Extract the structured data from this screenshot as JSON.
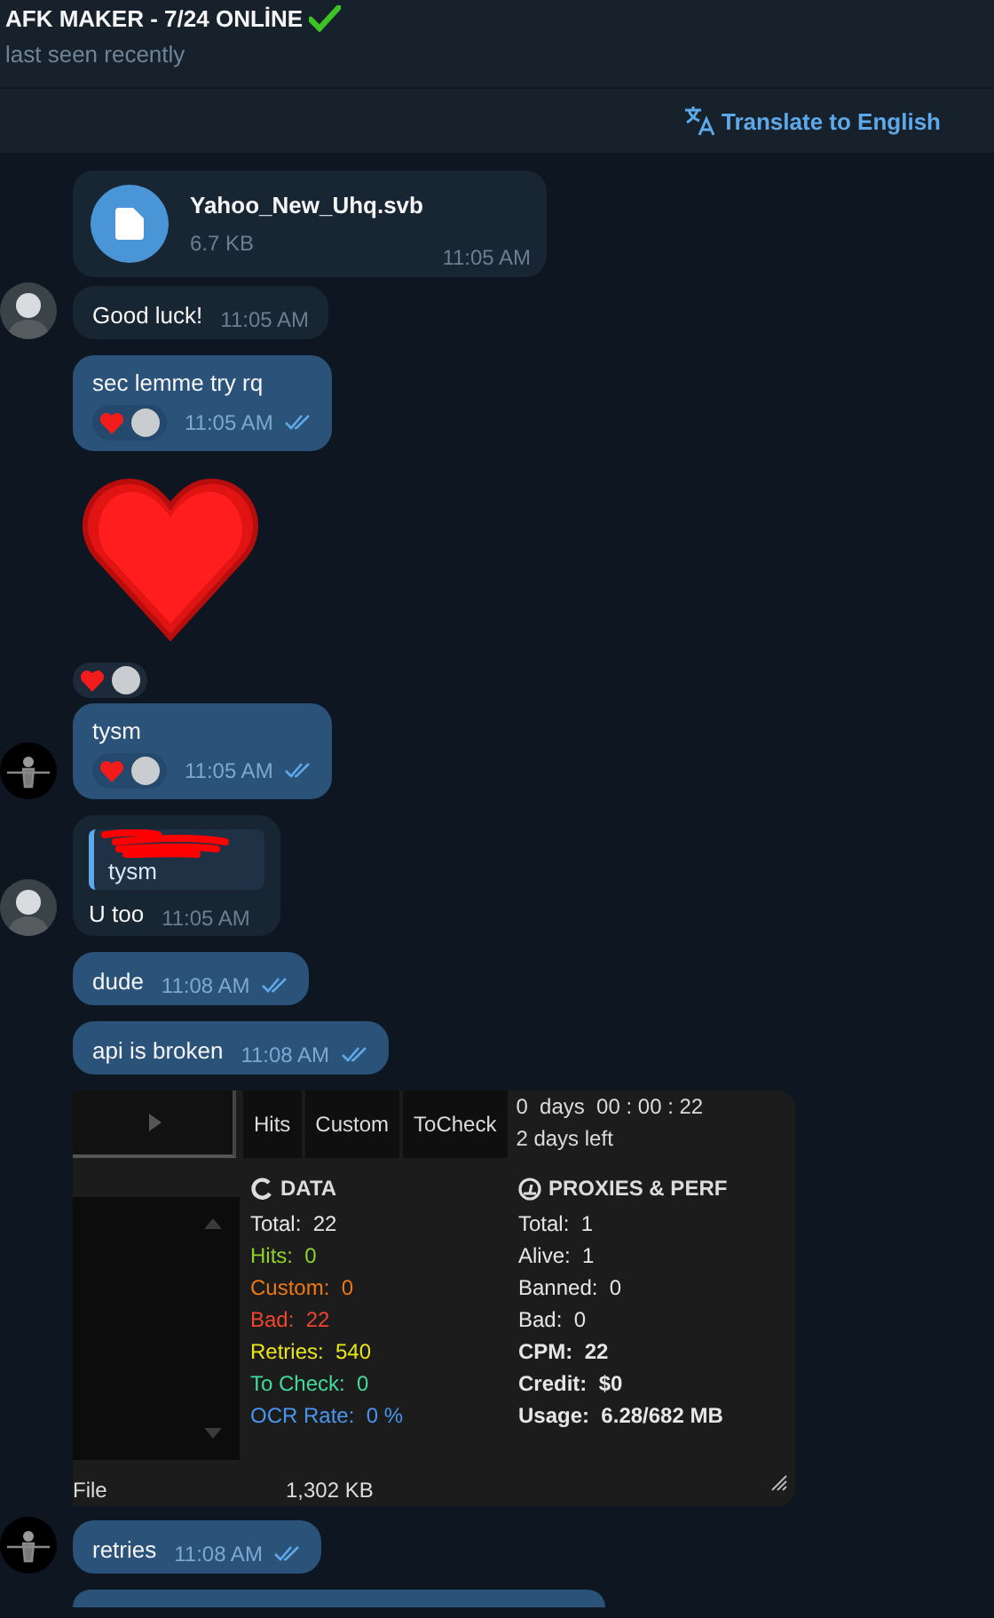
{
  "header": {
    "title": "AFK MAKER - 7/24 ONLİNE",
    "subtitle": "last seen recently"
  },
  "translate": {
    "label": "Translate to English"
  },
  "messages": [
    {
      "kind": "file",
      "outgoing": false,
      "name": "Yahoo_New_Uhq.svb",
      "size": "6.7 KB",
      "time": "11:05 AM"
    },
    {
      "kind": "text",
      "outgoing": false,
      "avatar": true,
      "text": "Good luck!",
      "time": "11:05 AM"
    },
    {
      "kind": "text",
      "outgoing": true,
      "text": "sec lemme try rq",
      "time": "11:05 AM",
      "read": true,
      "reactions": [
        {
          "kind": "heart"
        },
        {
          "kind": "avatar"
        }
      ]
    },
    {
      "kind": "sticker",
      "outgoing": true,
      "reactions": [
        {
          "kind": "heart"
        },
        {
          "kind": "avatar"
        }
      ]
    },
    {
      "kind": "text",
      "outgoing": true,
      "avatar": true,
      "text": "tysm",
      "time": "11:05 AM",
      "read": true,
      "reactions": [
        {
          "kind": "heart"
        },
        {
          "kind": "avatar"
        }
      ]
    },
    {
      "kind": "reply",
      "outgoing": false,
      "avatar": true,
      "quote": "tysm",
      "text": "U too",
      "time": "11:05 AM"
    },
    {
      "kind": "text",
      "outgoing": true,
      "text": "dude",
      "time": "11:08 AM",
      "read": true
    },
    {
      "kind": "text",
      "outgoing": true,
      "text": "api is broken",
      "time": "11:08 AM",
      "read": true
    },
    {
      "kind": "screenshot",
      "outgoing": true,
      "tabs": [
        "Hits",
        "Custom",
        "ToCheck"
      ],
      "timer": "0  days  00 : 00 : 22",
      "left": "2 days left",
      "data_title": "DATA",
      "proxies_title": "PROXIES & PERF",
      "data": [
        {
          "label": "Total:",
          "value": "22",
          "color": "#e6e6e6"
        },
        {
          "label": "Hits:",
          "value": "0",
          "color": "#8fd32a"
        },
        {
          "label": "Custom:",
          "value": "0",
          "color": "#f07a12"
        },
        {
          "label": "Bad:",
          "value": "22",
          "color": "#f0452f"
        },
        {
          "label": "Retries:",
          "value": "540",
          "color": "#e8e61a"
        },
        {
          "label": "To Check:",
          "value": "0",
          "color": "#3fdc9c"
        },
        {
          "label": "OCR Rate:",
          "value": "0 %",
          "color": "#4a96ef"
        }
      ],
      "proxies": [
        {
          "label": "Total:",
          "value": "1",
          "bold": false
        },
        {
          "label": "Alive:",
          "value": "1",
          "bold": false
        },
        {
          "label": "Banned:",
          "value": "0",
          "bold": false
        },
        {
          "label": "Bad:",
          "value": "0",
          "bold": false
        },
        {
          "label": "CPM:",
          "value": "22",
          "bold": true
        },
        {
          "label": "Credit:",
          "value": "$0",
          "bold": true
        },
        {
          "label": "Usage:",
          "value": "6.28/682 MB",
          "bold": true
        }
      ],
      "footer": [
        "File",
        "1,302 KB"
      ]
    },
    {
      "kind": "text",
      "outgoing": true,
      "avatar": true,
      "text": "retries",
      "time": "11:08 AM",
      "read": true
    }
  ]
}
